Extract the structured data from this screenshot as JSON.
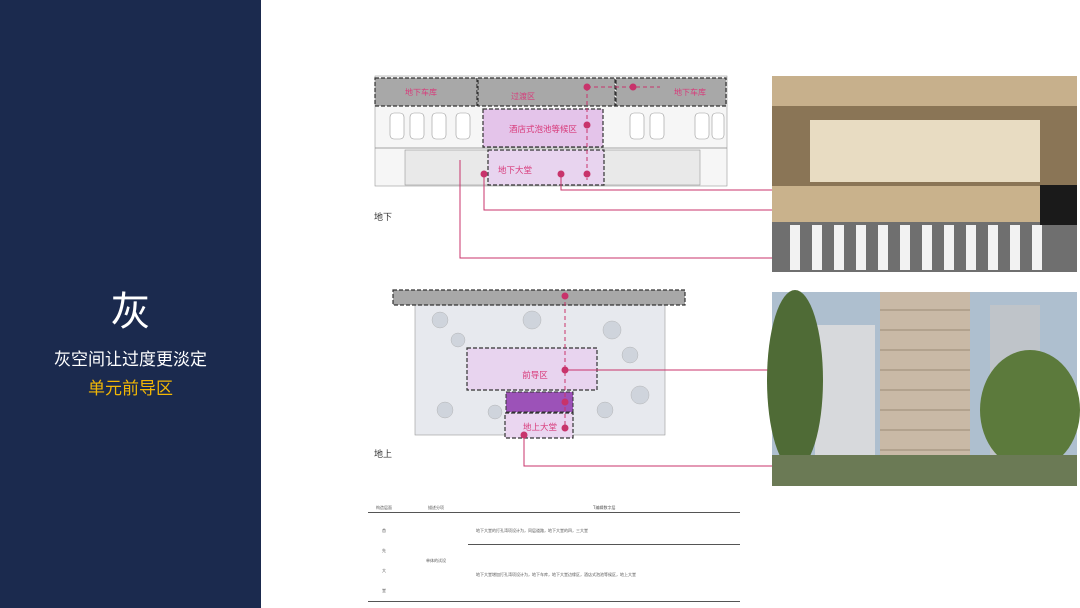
{
  "sidebar": {
    "big_char": "灰",
    "subtitle": "灰空间让过度更淡定",
    "subtitle2": "单元前导区"
  },
  "labels": {
    "underground": "地下",
    "above_ground": "地上"
  },
  "plan_top": {
    "zones": [
      "地下车库",
      "过渡区",
      "地下车库",
      "酒店式泡池等候区",
      "地下大堂"
    ]
  },
  "plan_bottom": {
    "zones": [
      "前导区",
      "地上大堂"
    ]
  },
  "table": {
    "headers": [
      "构造层面",
      "描述分项",
      "T编辑数字层"
    ],
    "left_col": [
      "首",
      "先",
      "大",
      "堂"
    ],
    "middle": "单体的试设",
    "rows": [
      "地下大堂的打孔湾项设计为，同层道路，地下大堂的四，三大堂",
      "地下大堂增加打孔湾项设计为，地下车库，地下大堂边缘区，酒店式泡池等候区，地上大堂"
    ]
  },
  "colors": {
    "sidebar": "#1b2a4e",
    "accent": "#f2b705",
    "leader": "#c8336b"
  }
}
